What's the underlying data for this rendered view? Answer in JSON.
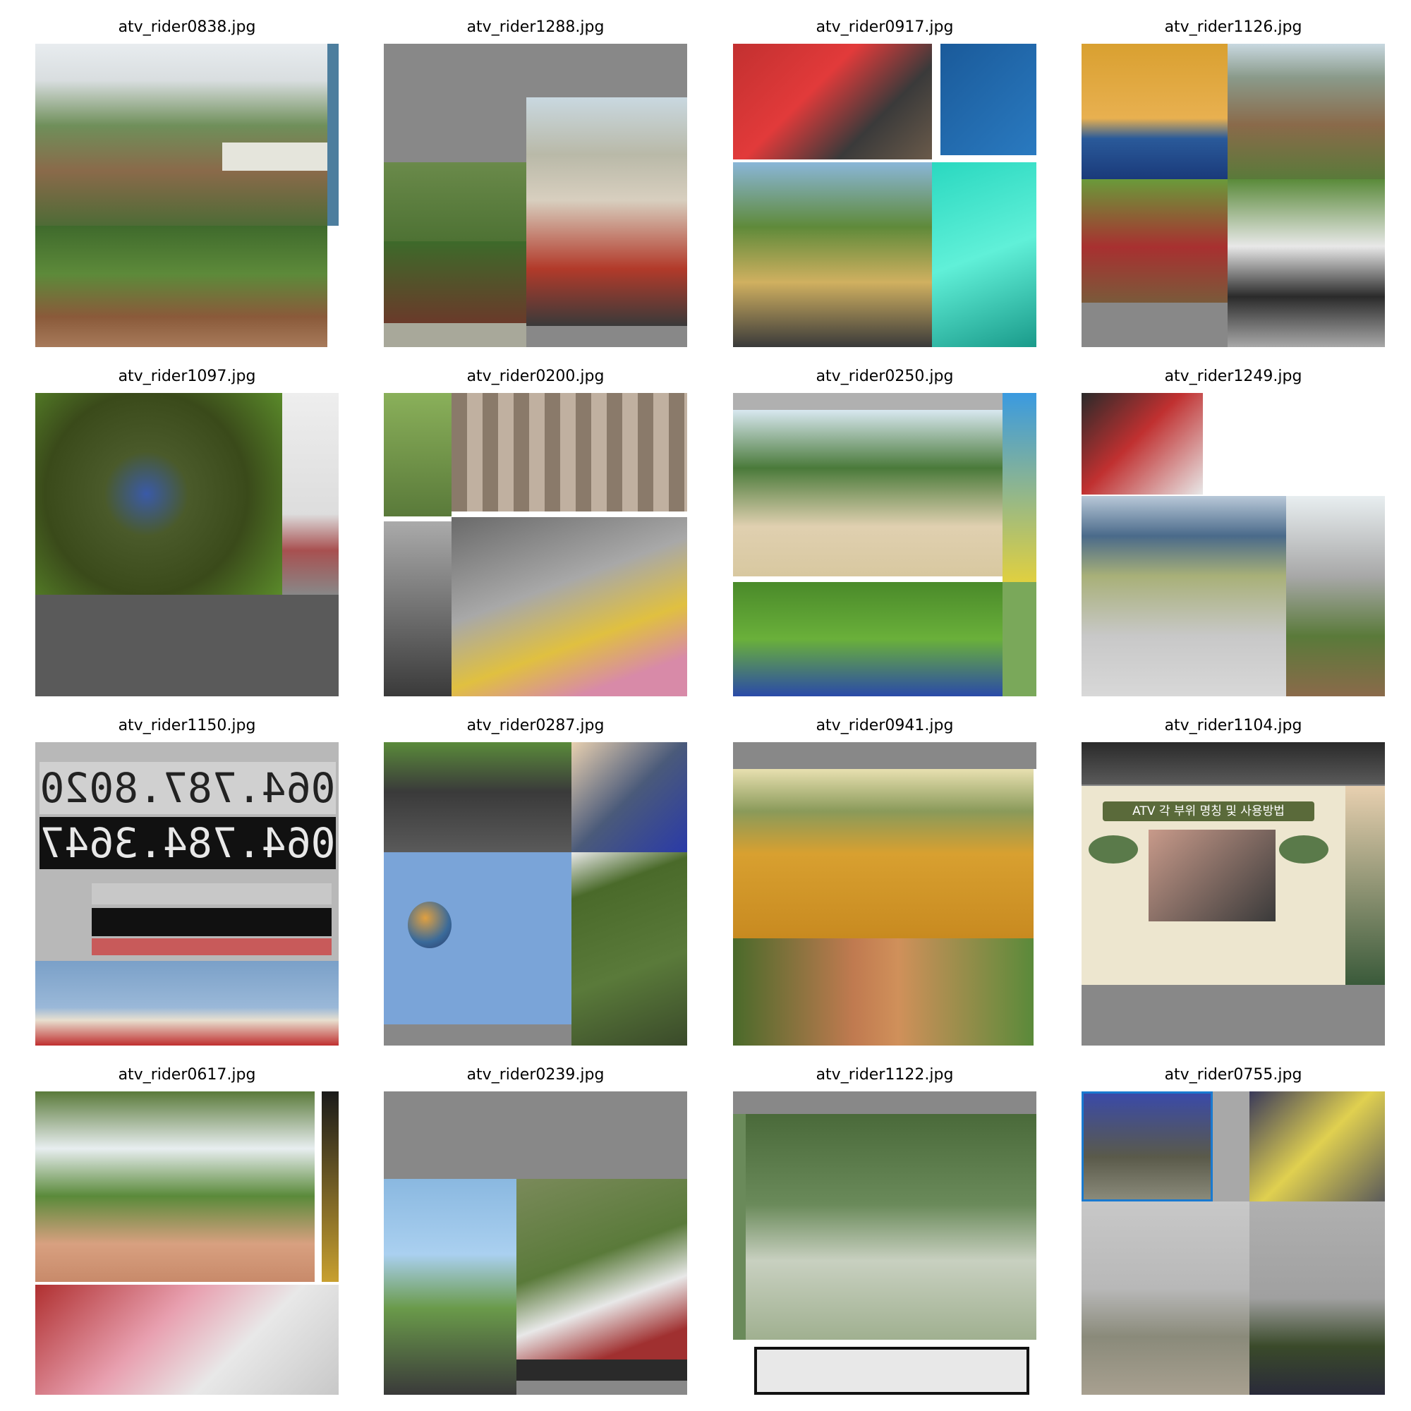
{
  "figure": {
    "panels": [
      {
        "filename": "atv_rider0838.jpg"
      },
      {
        "filename": "atv_rider1288.jpg"
      },
      {
        "filename": "atv_rider0917.jpg"
      },
      {
        "filename": "atv_rider1126.jpg"
      },
      {
        "filename": "atv_rider1097.jpg"
      },
      {
        "filename": "atv_rider0200.jpg"
      },
      {
        "filename": "atv_rider0250.jpg"
      },
      {
        "filename": "atv_rider1249.jpg"
      },
      {
        "filename": "atv_rider1150.jpg"
      },
      {
        "filename": "atv_rider0287.jpg"
      },
      {
        "filename": "atv_rider0941.jpg"
      },
      {
        "filename": "atv_rider1104.jpg"
      },
      {
        "filename": "atv_rider0617.jpg"
      },
      {
        "filename": "atv_rider0239.jpg"
      },
      {
        "filename": "atv_rider1122.jpg"
      },
      {
        "filename": "atv_rider0755.jpg"
      }
    ],
    "photo_text": {
      "phone_1": "064.787.8020",
      "phone_2": "064.784.3647",
      "sign_title": "ATV 각 부위 명칭 및 사용방법"
    },
    "colors": {
      "padding_gray": "#888888",
      "dark_gray": "#5a5a5a"
    }
  }
}
